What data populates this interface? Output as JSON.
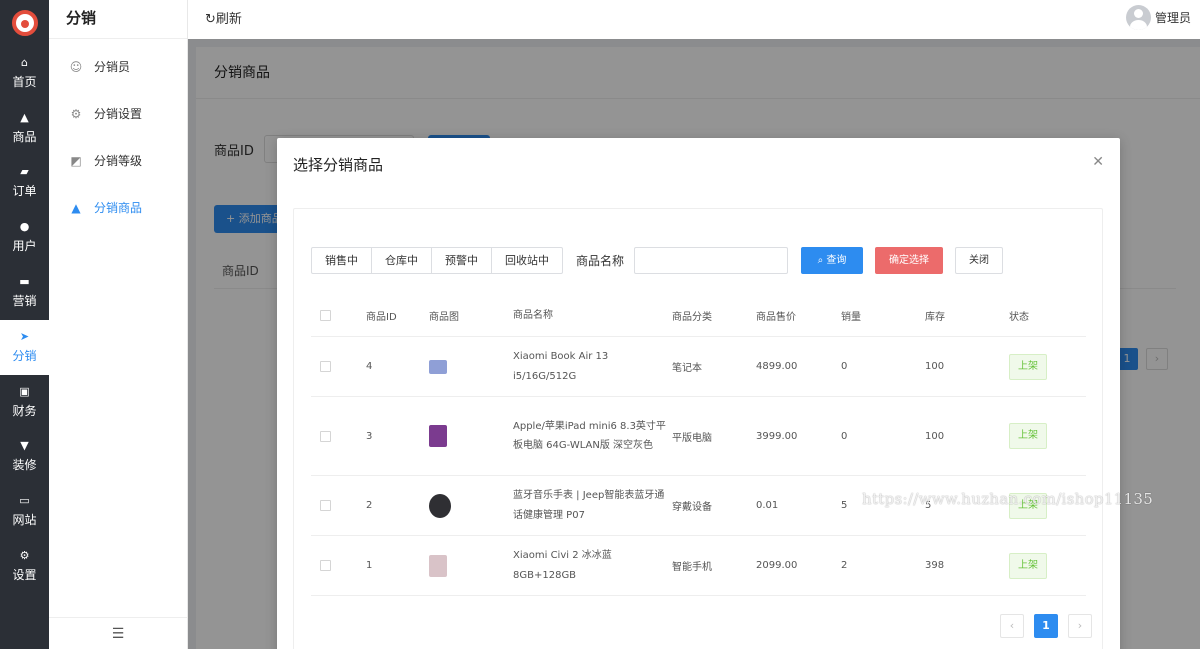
{
  "rail": {
    "items": [
      {
        "label": "首页",
        "icon": "home-icon"
      },
      {
        "label": "商品",
        "icon": "bag-icon"
      },
      {
        "label": "订单",
        "icon": "wallet-icon"
      },
      {
        "label": "用户",
        "icon": "user-icon"
      },
      {
        "label": "营销",
        "icon": "ticket-icon"
      },
      {
        "label": "分销",
        "icon": "send-icon",
        "active": true
      },
      {
        "label": "财务",
        "icon": "finance-icon"
      },
      {
        "label": "装修",
        "icon": "brush-icon"
      },
      {
        "label": "网站",
        "icon": "monitor-icon"
      },
      {
        "label": "设置",
        "icon": "gear-icon"
      }
    ]
  },
  "subnav": {
    "title": "分销",
    "items": [
      {
        "label": "分销员",
        "icon": "person-icon"
      },
      {
        "label": "分销设置",
        "icon": "settings-icon"
      },
      {
        "label": "分销等级",
        "icon": "chart-icon"
      },
      {
        "label": "分销商品",
        "icon": "bag-icon",
        "active": true
      }
    ]
  },
  "header": {
    "refresh_label": "刷新",
    "user_name": "管理员"
  },
  "page": {
    "title": "分销商品",
    "filter_label": "商品ID",
    "add_label": "+ 添加商品",
    "table_header": "商品ID",
    "pager_current": "1"
  },
  "modal": {
    "title": "选择分销商品",
    "segments": [
      "销售中",
      "仓库中",
      "预警中",
      "回收站中"
    ],
    "name_label": "商品名称",
    "name_value": "",
    "query_label": "查询",
    "confirm_label": "确定选择",
    "close_label": "关闭",
    "columns": [
      "商品ID",
      "商品图",
      "商品名称",
      "商品分类",
      "商品售价",
      "销量",
      "库存",
      "状态"
    ],
    "rows": [
      {
        "id": "4",
        "name": "Xiaomi Book Air 13 i5/16G/512G",
        "category": "笔记本",
        "price": "4899.00",
        "sales": "0",
        "stock": "100",
        "status": "上架",
        "thumb_color": "#8f9fd6"
      },
      {
        "id": "3",
        "name": "Apple/苹果iPad mini6 8.3英寸平板电脑 64G-WLAN版 深空灰色",
        "category": "平版电脑",
        "price": "3999.00",
        "sales": "0",
        "stock": "100",
        "status": "上架",
        "thumb_color": "#7b3b8f"
      },
      {
        "id": "2",
        "name": "蓝牙音乐手表 | Jeep智能表蓝牙通话健康管理 P07",
        "category": "穿戴设备",
        "price": "0.01",
        "sales": "5",
        "stock": "5",
        "status": "上架",
        "thumb_color": "#2f2f33"
      },
      {
        "id": "1",
        "name": "Xiaomi Civi 2 冰冰蓝 8GB+128GB",
        "category": "智能手机",
        "price": "2099.00",
        "sales": "2",
        "stock": "398",
        "status": "上架",
        "thumb_color": "#d9c3c8"
      }
    ],
    "pager": {
      "prev": "‹",
      "current": "1",
      "next": "›"
    }
  },
  "watermark": "https://www.huzhan.com/ishop11135"
}
